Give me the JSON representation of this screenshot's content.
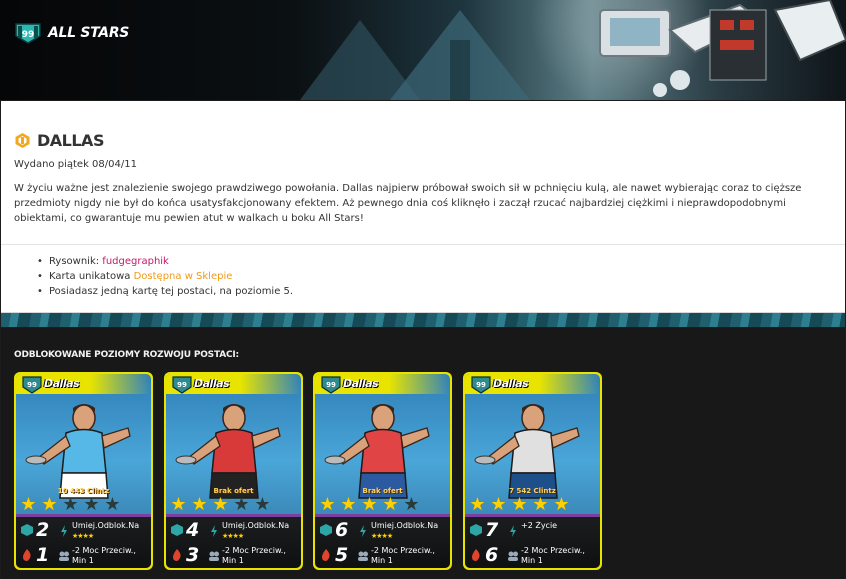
{
  "header": {
    "clan_badge": "99",
    "clan_name": "ALL STARS"
  },
  "character": {
    "name": "DALLAS",
    "release": "Wydano piątek 08/04/11",
    "description": "W życiu ważne jest znalezienie swojego prawdziwego powołania. Dallas najpierw próbował swoich sił w pchnięciu kulą, ale nawet wybierając coraz to cięższe przedmioty nigdy nie był do końca usatysfakcjonowany efektem. Aż pewnego dnia coś kliknęło i zaczął rzucać najbardziej ciężkimi i nieprawdopodobnymi obiektami, co gwarantuje mu pewien atut w walkach u boku All Stars!",
    "details": {
      "artist_label": "Rysownik:",
      "artist_name": "fudgegraphik",
      "card_label": "Karta unikatowa",
      "card_link": "Dostępna w Sklepie",
      "level_note": "Posiadasz jedną kartę tej postaci, na poziomie 5."
    }
  },
  "levels_title": "ODBLOKOWANE POZIOMY ROZWOJU POSTACI:",
  "cards": [
    {
      "badge": "99",
      "name": "Dallas",
      "price": "10 443 Clintz",
      "stars_on": 2,
      "stars_total": 5,
      "power": "2",
      "damage": "1",
      "ability": "Umiej.Odblok.Na",
      "ability_stars": "★★★★",
      "bonus_line1": "-2 Moc Przeciw.,",
      "bonus_line2": "Min 1",
      "colors": {
        "shirt": "#55b8e6",
        "shorts": "#ffffff"
      }
    },
    {
      "badge": "99",
      "name": "Dallas",
      "price": "Brak ofert",
      "stars_on": 3,
      "stars_total": 5,
      "power": "4",
      "damage": "3",
      "ability": "Umiej.Odblok.Na",
      "ability_stars": "★★★★",
      "bonus_line1": "-2 Moc Przeciw.,",
      "bonus_line2": "Min 1",
      "colors": {
        "shirt": "#d83a3a",
        "shorts": "#222222"
      }
    },
    {
      "badge": "99",
      "name": "Dallas",
      "price": "Brak ofert",
      "stars_on": 4,
      "stars_total": 5,
      "power": "6",
      "damage": "5",
      "ability": "Umiej.Odblok.Na",
      "ability_stars": "★★★★",
      "bonus_line1": "-2 Moc Przeciw.,",
      "bonus_line2": "Min 1",
      "colors": {
        "shirt": "#e14444",
        "shorts": "#2c5aa0"
      }
    },
    {
      "badge": "99",
      "name": "Dallas",
      "price": "7 542 Clintz",
      "stars_on": 5,
      "stars_total": 5,
      "power": "7",
      "damage": "6",
      "ability": "+2 Życie",
      "ability_stars": "",
      "bonus_line1": "-2 Moc Przeciw.,",
      "bonus_line2": "Min 1",
      "colors": {
        "shirt": "#e0e0e0",
        "shorts": "#1d4f8a"
      }
    }
  ],
  "theme": {
    "card_frame": "#e9e300",
    "link_pink": "#c2186b",
    "link_orange": "#f09a18",
    "star": "#ffd000"
  }
}
